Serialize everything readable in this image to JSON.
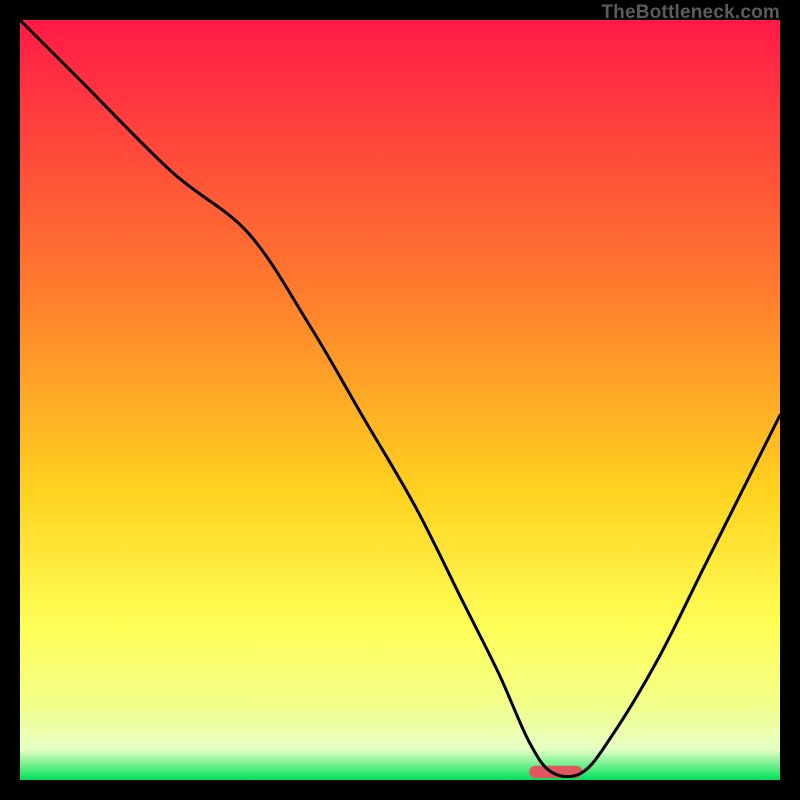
{
  "watermark": "TheBottleneck.com",
  "colors": {
    "top": "#ff1a47",
    "mid1": "#ff7a2e",
    "mid2": "#ffd21f",
    "mid3": "#ffff58",
    "mid4": "#f3ff8a",
    "band": "#e5ffc4",
    "green": "#00e05a",
    "marker": "#e0575f",
    "curve": "#000000",
    "frame": "#000000"
  },
  "chart_data": {
    "type": "line",
    "title": "",
    "xlabel": "",
    "ylabel": "",
    "xlim": [
      0,
      100
    ],
    "ylim": [
      0,
      100
    ],
    "optimum_x": [
      67,
      74
    ],
    "series": [
      {
        "name": "bottleneck-curve",
        "x": [
          0,
          8,
          20,
          30,
          38,
          45,
          52,
          58,
          63,
          67,
          70,
          74,
          78,
          84,
          90,
          96,
          100
        ],
        "values": [
          100,
          92,
          80,
          72,
          60,
          48,
          36,
          24,
          14,
          5,
          1,
          1,
          6,
          16,
          28,
          40,
          48
        ]
      }
    ],
    "marker": {
      "x_center": 70.5,
      "width": 7,
      "height": 1.6
    }
  }
}
